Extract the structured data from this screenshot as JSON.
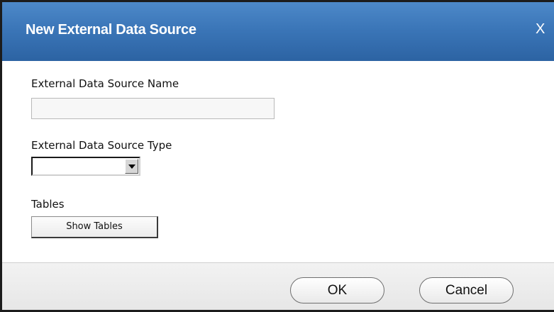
{
  "dialog": {
    "title": "New External Data Source",
    "close_label": "X"
  },
  "form": {
    "name_label": "External Data Source Name",
    "name_value": "",
    "type_label": "External Data Source Type",
    "type_value": "",
    "tables_label": "Tables",
    "show_tables_label": "Show Tables"
  },
  "footer": {
    "ok_label": "OK",
    "cancel_label": "Cancel"
  },
  "colors": {
    "titlebar": "#3b76b8",
    "title_text": "#ffffff",
    "footer_bg": "#ececec"
  },
  "icons": {
    "dropdown": "triangle-down-icon"
  }
}
